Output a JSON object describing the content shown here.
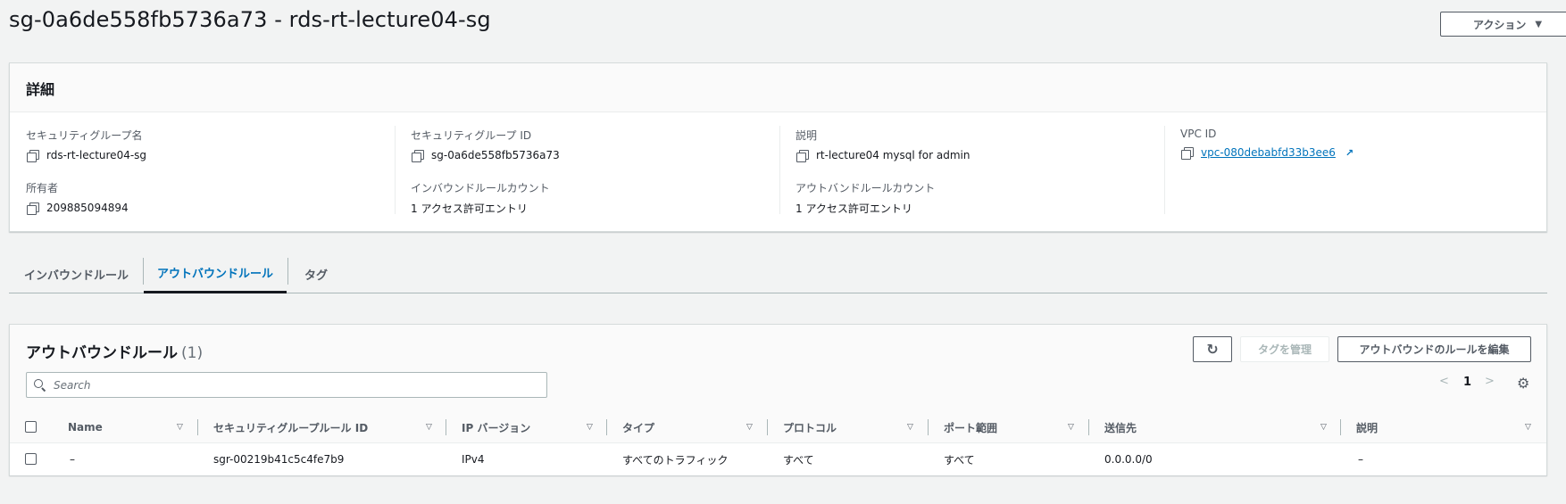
{
  "header": {
    "title": "sg-0a6de558fb5736a73 - rds-rt-lecture04-sg",
    "actions_label": "アクション"
  },
  "details": {
    "heading": "詳細",
    "fields": {
      "sg_name": {
        "label": "セキュリティグループ名",
        "value": "rds-rt-lecture04-sg"
      },
      "sg_id": {
        "label": "セキュリティグループ ID",
        "value": "sg-0a6de558fb5736a73"
      },
      "description": {
        "label": "説明",
        "value": "rt-lecture04 mysql for admin"
      },
      "vpc_id": {
        "label": "VPC ID",
        "value": "vpc-080debabfd33b3ee6"
      },
      "owner": {
        "label": "所有者",
        "value": "209885094894"
      },
      "inbound_count": {
        "label": "インバウンドルールカウント",
        "value": "1 アクセス許可エントリ"
      },
      "outbound_count": {
        "label": "アウトバンドルールカウント",
        "value": "1 アクセス許可エントリ"
      }
    }
  },
  "tabs": [
    {
      "label": "インバウンドルール"
    },
    {
      "label": "アウトバウンドルール",
      "active": true
    },
    {
      "label": "タグ"
    }
  ],
  "rules": {
    "title": "アウトバウンドルール",
    "count": "(1)",
    "manage_tags_label": "タグを管理",
    "edit_label": "アウトバウンドのルールを編集",
    "search_placeholder": "Search",
    "page": "1",
    "columns": [
      "Name",
      "セキュリティグループルール ID",
      "IP バージョン",
      "タイプ",
      "プロトコル",
      "ポート範囲",
      "送信先",
      "説明"
    ],
    "rows": [
      [
        "–",
        "sgr-00219b41c5c4fe7b9",
        "IPv4",
        "すべてのトラフィック",
        "すべて",
        "すべて",
        "0.0.0.0/0",
        "–"
      ]
    ]
  },
  "colors": {
    "accent": "#0073bb",
    "background": "#f2f3f3"
  }
}
